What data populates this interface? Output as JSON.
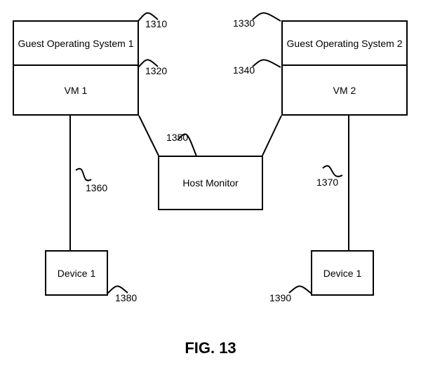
{
  "boxes": {
    "guest1": "Guest Operating System 1",
    "vm1": "VM 1",
    "guest2": "Guest Operating System 2",
    "vm2": "VM 2",
    "host": "Host Monitor",
    "dev1": "Device 1",
    "dev2": "Device 1"
  },
  "refs": {
    "r1310": "1310",
    "r1320": "1320",
    "r1330": "1330",
    "r1340": "1340",
    "r1350": "1350",
    "r1360": "1360",
    "r1370": "1370",
    "r1380": "1380",
    "r1390": "1390"
  },
  "figure": "FIG. 13"
}
